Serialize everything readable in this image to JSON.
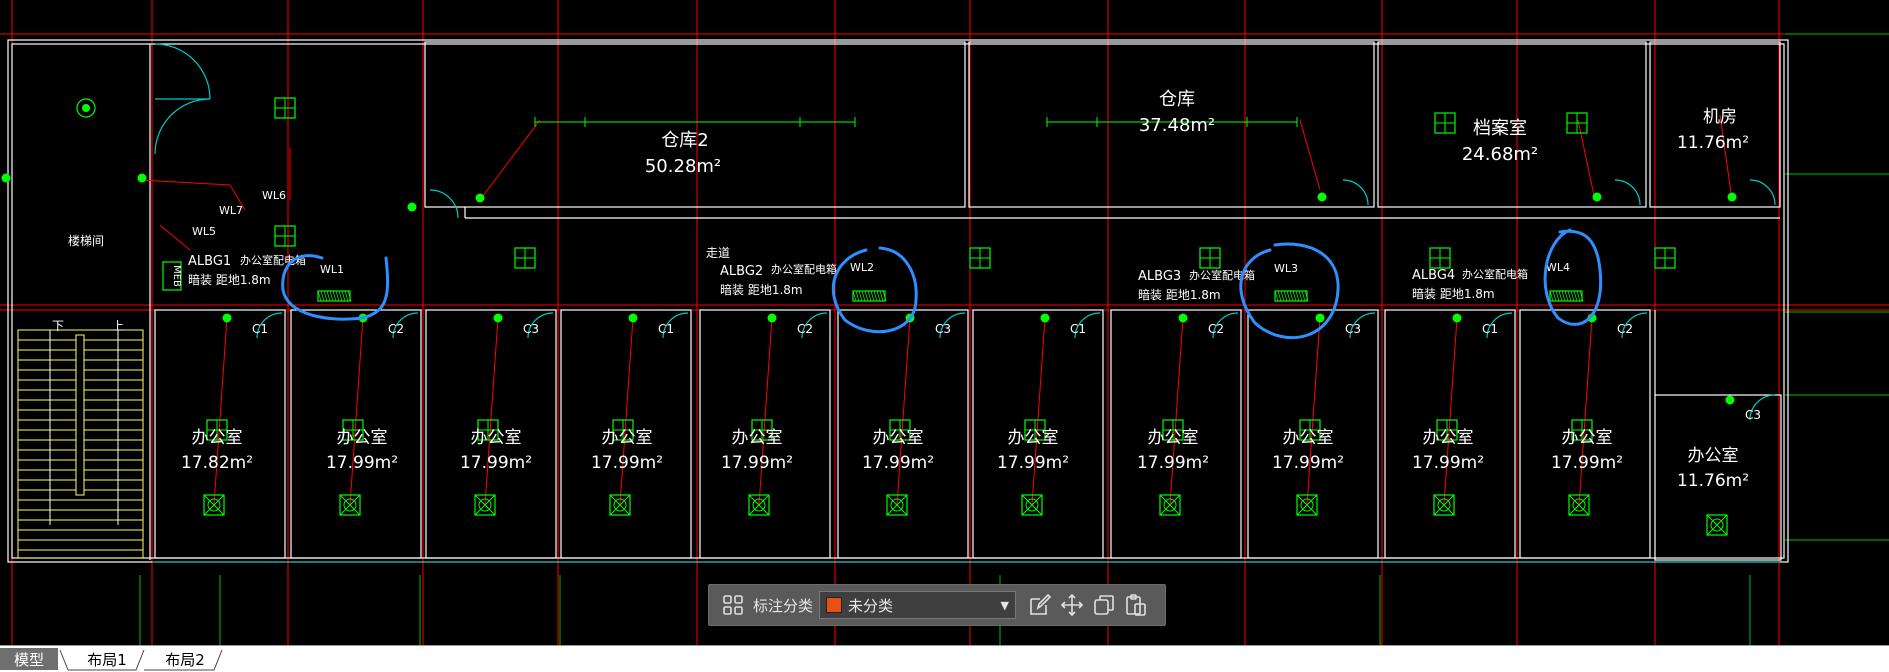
{
  "drawing": {
    "rooms": [
      {
        "name": "仓库2",
        "area": "50.28m²"
      },
      {
        "name": "仓库",
        "area": "37.48m²"
      },
      {
        "name": "档案室",
        "area": "24.68m²"
      },
      {
        "name": "机房",
        "area": "11.76m²"
      },
      {
        "name": "楼梯间",
        "area": ""
      },
      {
        "name": "走道",
        "area": ""
      }
    ],
    "offices": [
      {
        "name": "办公室",
        "area": "17.82m²"
      },
      {
        "name": "办公室",
        "area": "17.99m²"
      },
      {
        "name": "办公室",
        "area": "17.99m²"
      },
      {
        "name": "办公室",
        "area": "17.99m²"
      },
      {
        "name": "办公室",
        "area": "17.99m²"
      },
      {
        "name": "办公室",
        "area": "17.99m²"
      },
      {
        "name": "办公室",
        "area": "17.99m²"
      },
      {
        "name": "办公室",
        "area": "17.99m²"
      },
      {
        "name": "办公室",
        "area": "17.99m²"
      },
      {
        "name": "办公室",
        "area": "17.99m²"
      },
      {
        "name": "办公室",
        "area": "17.99m²"
      },
      {
        "name": "办公室",
        "area": "11.76m²"
      }
    ],
    "panels": [
      {
        "code": "ALBG1",
        "desc": "办公室配电箱",
        "mount": "暗装 距地1.8m",
        "circuit": "WL1"
      },
      {
        "code": "ALBG2",
        "desc": "办公室配电箱",
        "mount": "暗装 距地1.8m",
        "circuit": "WL2"
      },
      {
        "code": "ALBG3",
        "desc": "办公室配电箱",
        "mount": "暗装 距地1.8m",
        "circuit": "WL3"
      },
      {
        "code": "ALBG4",
        "desc": "办公室配电箱",
        "mount": "暗装 距地1.8m",
        "circuit": "WL4"
      }
    ],
    "circuits_left": [
      "WL5",
      "WL6",
      "WL7"
    ],
    "meb": "MEB",
    "stairs": {
      "down": "下",
      "up": "上"
    },
    "door_tags": [
      "C1",
      "C2",
      "C3",
      "C1",
      "C2",
      "C3",
      "C1",
      "C2",
      "C3",
      "C1",
      "C2",
      "C3"
    ],
    "colors": {
      "background": "#000000",
      "grid_axis": "#ff0000",
      "wall": "#ffffff",
      "door": "#00c8c8",
      "equipment": "#00ff00",
      "stair": "#ffff66",
      "markup": "#2f8fff"
    }
  },
  "annotation_toolbar": {
    "label": "标注分类",
    "selected_category": "未分类",
    "selected_color": "#e8520e",
    "icons": [
      "grid-icon",
      "edit-icon",
      "move-icon",
      "copy-icon",
      "paste-icon"
    ]
  },
  "layout_tabs": [
    {
      "label": "模型",
      "active": true
    },
    {
      "label": "布局1",
      "active": false
    },
    {
      "label": "布局2",
      "active": false
    }
  ]
}
